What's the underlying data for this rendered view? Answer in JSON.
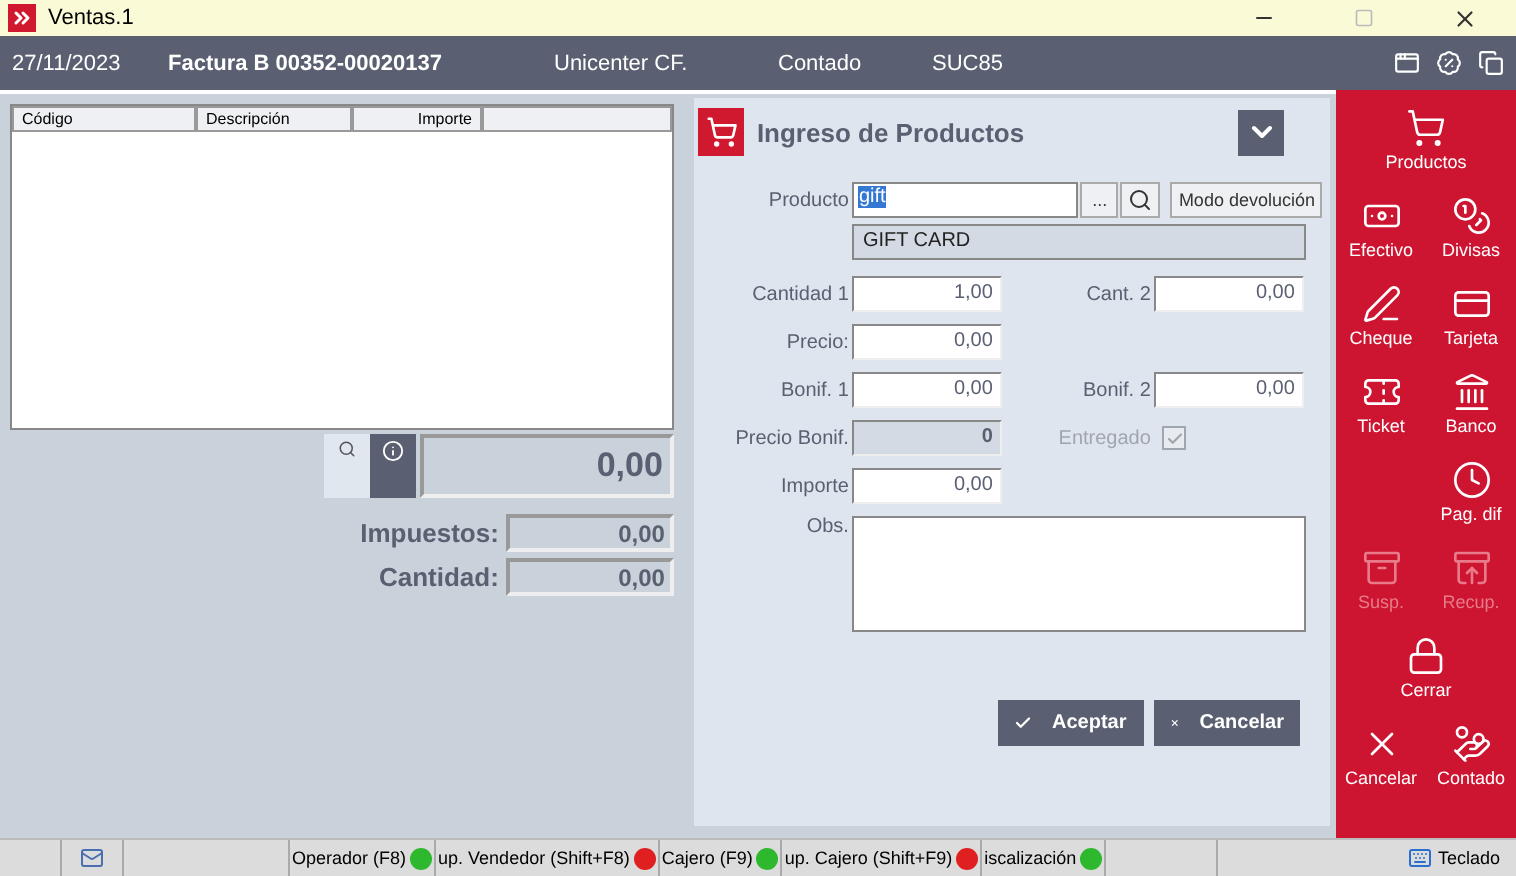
{
  "window": {
    "title": "Ventas.1"
  },
  "header": {
    "date": "27/11/2023",
    "document": "Factura B 00352-00020137",
    "client": "Unicenter CF.",
    "condition": "Contado",
    "branch": "SUC85"
  },
  "items_table": {
    "columns": [
      "Código",
      "Descripción",
      "Importe"
    ]
  },
  "totals": {
    "total": "0,00",
    "taxes_label": "Impuestos:",
    "taxes": "0,00",
    "quantity_label": "Cantidad:",
    "quantity": "0,00"
  },
  "product_entry": {
    "title": "Ingreso de Productos",
    "product_label": "Producto",
    "product_value": "gift",
    "browse_button": "...",
    "return_mode_button": "Modo devolución",
    "description": "GIFT CARD",
    "rows": [
      {
        "left": {
          "kind": "field",
          "label": "Cantidad 1",
          "value": "1,00",
          "disabled": false
        },
        "right": {
          "kind": "field",
          "label": "Cant. 2",
          "value": "0,00",
          "disabled": false
        }
      },
      {
        "left": {
          "kind": "field",
          "label": "Precio:",
          "value": "0,00",
          "disabled": false
        }
      },
      {
        "left": {
          "kind": "field",
          "label": "Bonif. 1",
          "value": "0,00",
          "disabled": false
        },
        "right": {
          "kind": "field",
          "label": "Bonif. 2",
          "value": "0,00",
          "disabled": false
        }
      },
      {
        "left": {
          "kind": "field",
          "label": "Precio Bonif.",
          "value": "0",
          "disabled": true
        },
        "right": {
          "kind": "checkbox",
          "label": "Entregado",
          "checked": true,
          "disabled": true
        }
      },
      {
        "left": {
          "kind": "field",
          "label": "Importe",
          "value": "0,00",
          "disabled": false
        }
      }
    ],
    "notes_label": "Obs.",
    "buttons": [
      {
        "kind": "accept",
        "label": "Aceptar"
      },
      {
        "kind": "cancel",
        "label": "Cancelar"
      }
    ]
  },
  "action_rows": [
    {
      "center": {
        "kind": "cart",
        "label": "Productos",
        "disabled": false
      }
    },
    {
      "left": {
        "kind": "cash",
        "label": "Efectivo",
        "disabled": false
      },
      "right": {
        "kind": "currency",
        "label": "Divisas",
        "disabled": false
      }
    },
    {
      "left": {
        "kind": "cheque",
        "label": "Cheque",
        "disabled": false
      },
      "right": {
        "kind": "card",
        "label": "Tarjeta",
        "disabled": false
      }
    },
    {
      "left": {
        "kind": "ticket",
        "label": "Ticket",
        "disabled": false
      },
      "right": {
        "kind": "bank",
        "label": "Banco",
        "disabled": false
      }
    },
    {
      "right": {
        "kind": "deferred",
        "label": "Pag. dif",
        "disabled": false
      }
    },
    {
      "left": {
        "kind": "suspend",
        "label": "Susp.",
        "disabled": true
      },
      "right": {
        "kind": "recover",
        "label": "Recup.",
        "disabled": true
      }
    },
    {
      "center": {
        "kind": "lock",
        "label": "Cerrar",
        "disabled": false
      }
    },
    {
      "left": {
        "kind": "cancel",
        "label": "Cancelar",
        "disabled": false
      },
      "right": {
        "kind": "pay",
        "label": "Contado",
        "disabled": false
      }
    }
  ],
  "status_bar": {
    "indicators": [
      {
        "label": "Operador (F8)",
        "color": "#2eb82e"
      },
      {
        "label": "up. Vendedor (Shift+F8)",
        "color": "#e02020"
      },
      {
        "label": "Cajero (F9)",
        "color": "#2eb82e"
      },
      {
        "label": "up. Cajero (Shift+F9)",
        "color": "#e02020"
      },
      {
        "label": "iscalización",
        "color": "#2eb82e"
      }
    ],
    "keyboard": "Teclado"
  }
}
